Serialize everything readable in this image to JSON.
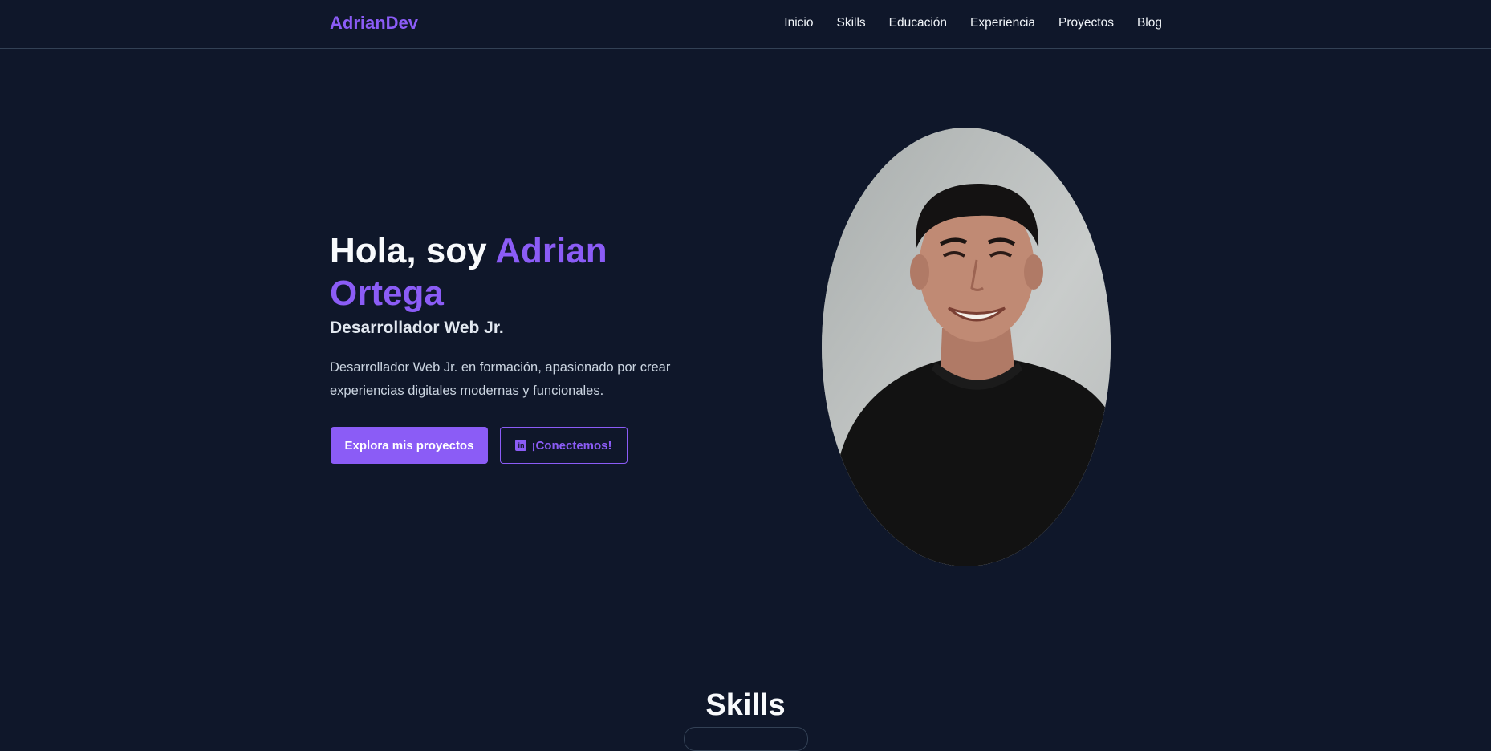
{
  "nav": {
    "brand": "AdrianDev",
    "links": [
      "Inicio",
      "Skills",
      "Educación",
      "Experiencia",
      "Proyectos",
      "Blog"
    ]
  },
  "hero": {
    "greeting": "Hola, soy ",
    "name": "Adrian Ortega",
    "role": "Desarrollador Web Jr.",
    "description": "Desarrollador Web Jr. en formación, apasionado por crear experiencias digitales modernas y funcionales.",
    "cta_primary": "Explora mis proyectos",
    "cta_secondary": "¡Conectemos!",
    "cta_secondary_icon": "linkedin-icon"
  },
  "sections": {
    "skills_title": "Skills"
  },
  "colors": {
    "background": "#0f172a",
    "accent": "#8b5cf6",
    "text": "#f1f5f9"
  }
}
